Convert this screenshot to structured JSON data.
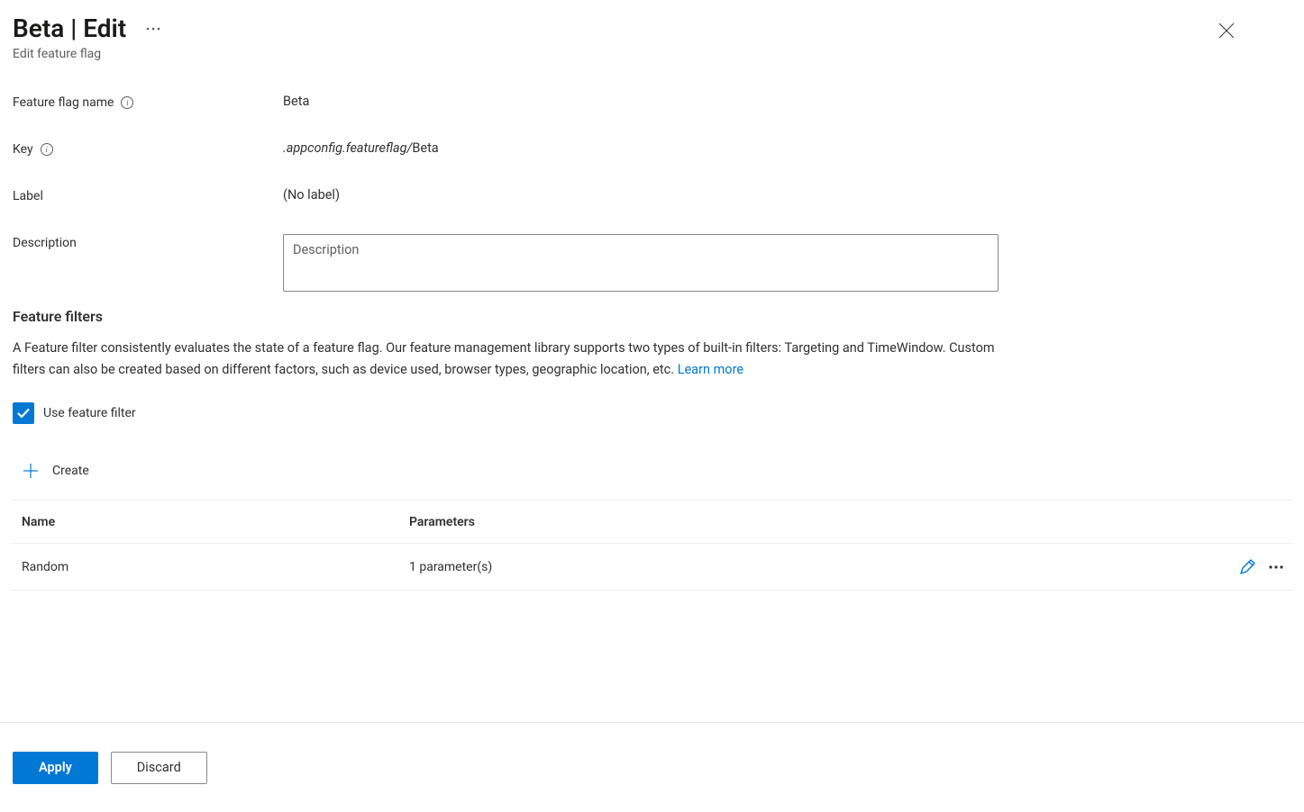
{
  "header": {
    "title": "Beta | Edit",
    "subtitle": "Edit feature flag"
  },
  "form": {
    "name_label": "Feature flag name",
    "name_value": "Beta",
    "key_label": "Key",
    "key_prefix": ".appconfig.featureflag/",
    "key_value": "Beta",
    "label_label": "Label",
    "label_value": "(No label)",
    "description_label": "Description",
    "description_placeholder": "Description"
  },
  "filters": {
    "heading": "Feature filters",
    "description": "A Feature filter consistently evaluates the state of a feature flag. Our feature management library supports two types of built-in filters: Targeting and TimeWindow. Custom filters can also be created based on different factors, such as device used, browser types, geographic location, etc. ",
    "learn_more": "Learn more",
    "checkbox_label": "Use feature filter",
    "checkbox_checked": true,
    "create_label": "Create",
    "table": {
      "col_name": "Name",
      "col_params": "Parameters",
      "rows": [
        {
          "name": "Random",
          "params": "1 parameter(s)"
        }
      ]
    }
  },
  "footer": {
    "apply": "Apply",
    "discard": "Discard"
  }
}
